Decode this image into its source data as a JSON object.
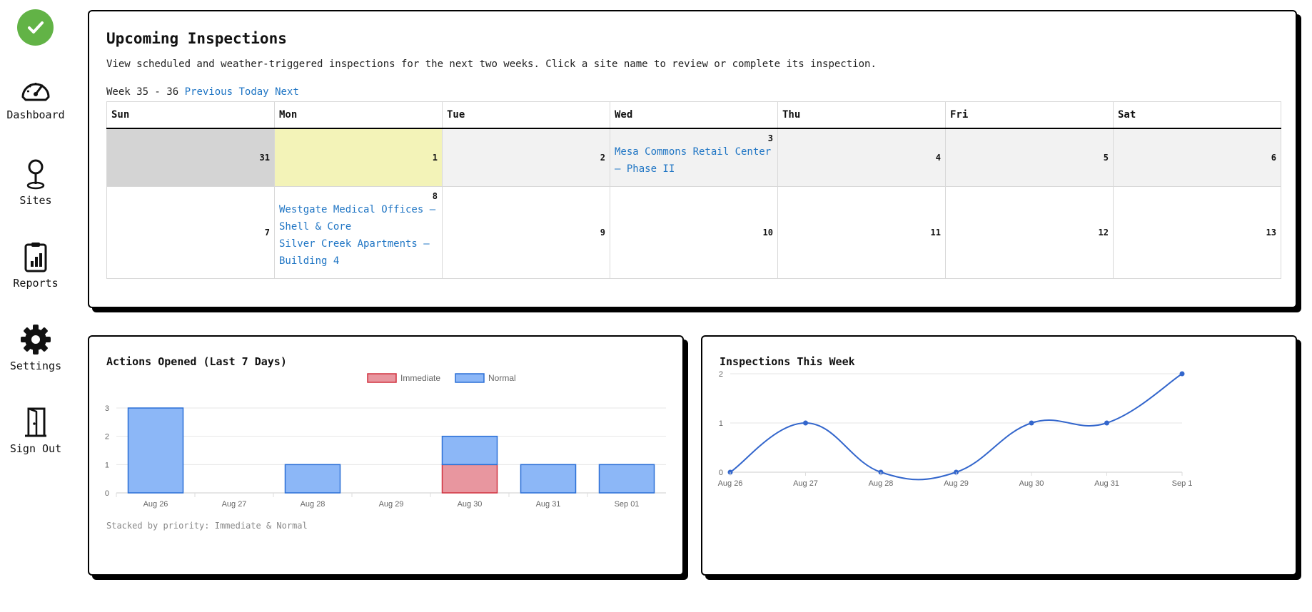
{
  "sidebar": {
    "items": [
      {
        "label": "Dashboard",
        "icon": "speedometer-icon"
      },
      {
        "label": "Sites",
        "icon": "map-pin-icon"
      },
      {
        "label": "Reports",
        "icon": "clipboard-chart-icon"
      },
      {
        "label": "Settings",
        "icon": "gear-icon"
      },
      {
        "label": "Sign Out",
        "icon": "door-icon"
      }
    ],
    "logo_color": "#62b346"
  },
  "calendar": {
    "title": "Upcoming Inspections",
    "description": "View scheduled and weather-triggered inspections for the next two weeks. Click a site name to review or complete its inspection.",
    "week_label": "Week 35 - 36",
    "nav": {
      "previous": "Previous",
      "today": "Today",
      "next": "Next"
    },
    "headers": [
      "Sun",
      "Mon",
      "Tue",
      "Wed",
      "Thu",
      "Fri",
      "Sat"
    ],
    "week1": [
      "31",
      "1",
      "2",
      "3",
      "4",
      "5",
      "6"
    ],
    "week2": [
      "7",
      "8",
      "9",
      "10",
      "11",
      "12",
      "13"
    ],
    "events": {
      "wed_3": [
        "Mesa Commons Retail Center – Phase II"
      ],
      "mon_8": [
        "Westgate Medical Offices – Shell & Core",
        "Silver Creek Apartments – Building 4"
      ]
    }
  },
  "actions_chart": {
    "title": "Actions Opened (Last 7 Days)",
    "note": "Stacked by priority: Immediate & Normal"
  },
  "inspections_chart": {
    "title": "Inspections This Week"
  },
  "chart_data": [
    {
      "type": "bar",
      "stacked": true,
      "categories": [
        "Aug 26",
        "Aug 27",
        "Aug 28",
        "Aug 29",
        "Aug 30",
        "Aug 31",
        "Sep 01"
      ],
      "series": [
        {
          "name": "Immediate",
          "values": [
            0,
            0,
            0,
            0,
            1,
            0,
            0
          ],
          "color": "#e8969f",
          "border": "#d0313f"
        },
        {
          "name": "Normal",
          "values": [
            3,
            0,
            1,
            0,
            1,
            1,
            1
          ],
          "color": "#8cb7f7",
          "border": "#2a6fd6"
        }
      ],
      "ylim": [
        0,
        3
      ],
      "yticks": [
        "0",
        "1",
        "2",
        "3"
      ],
      "legend": "top",
      "grid": true
    },
    {
      "type": "line",
      "categories": [
        "Aug 26",
        "Aug 27",
        "Aug 28",
        "Aug 29",
        "Aug 30",
        "Aug 31",
        "Sep 1"
      ],
      "series": [
        {
          "values": [
            0,
            1,
            0,
            0,
            1,
            1,
            2
          ],
          "color": "#3366cc"
        }
      ],
      "ylim": [
        0,
        2
      ],
      "yticks": [
        "0",
        "1",
        "2"
      ],
      "grid": true
    }
  ]
}
